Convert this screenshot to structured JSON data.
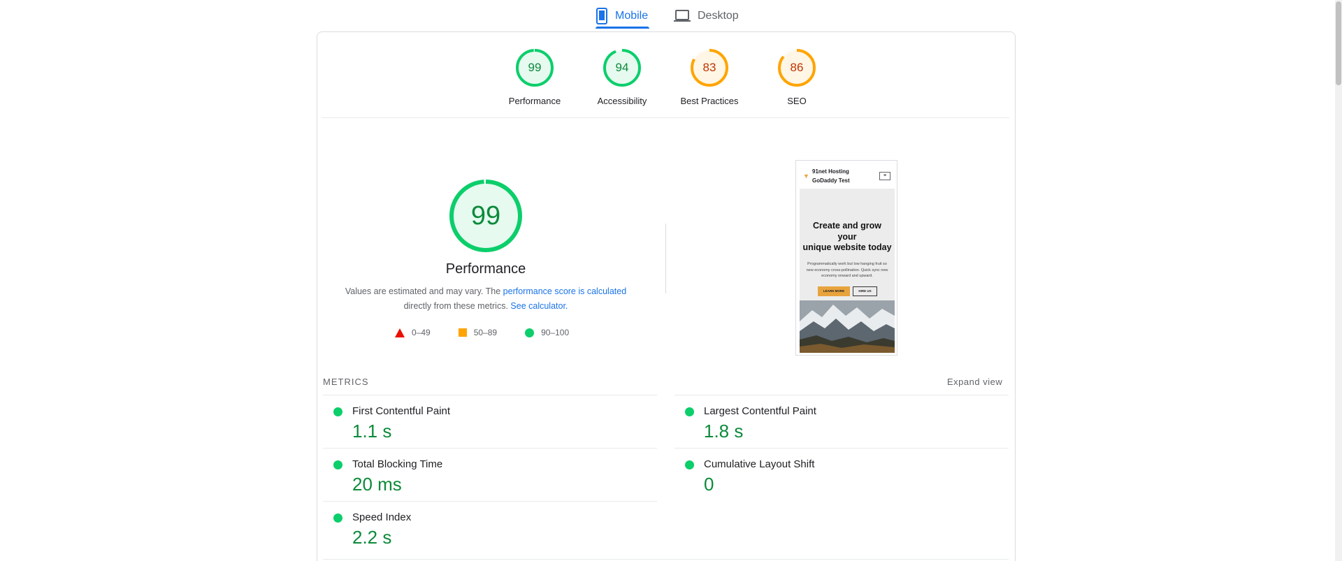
{
  "tabs": {
    "mobile_label": "Mobile",
    "desktop_label": "Desktop"
  },
  "categories": [
    {
      "name": "Performance",
      "score": 99,
      "status": "pass"
    },
    {
      "name": "Accessibility",
      "score": 94,
      "status": "pass"
    },
    {
      "name": "Best Practices",
      "score": 83,
      "status": "average"
    },
    {
      "name": "SEO",
      "score": 86,
      "status": "average"
    }
  ],
  "performance": {
    "score": 99,
    "title": "Performance",
    "desc_prefix": "Values are estimated and may vary. The",
    "desc_link1": "performance score is calculated",
    "desc_middle": "directly from these metrics.",
    "desc_link2": "See calculator.",
    "legend": [
      {
        "shape": "triangle-icon",
        "range": "0–49",
        "color": "#eb0f00"
      },
      {
        "shape": "square-icon",
        "range": "50–89",
        "color": "#ffa400"
      },
      {
        "shape": "circle-icon",
        "range": "90–100",
        "color": "#0cce6b"
      }
    ]
  },
  "screenshot": {
    "brand_line1": "91net Hosting",
    "brand_line2": "GoDaddy Test",
    "menu_icon": "≡",
    "headline_line1": "Create and grow",
    "headline_line2": "your",
    "headline_line3": "unique website today",
    "body": "Programmatically work but low hanging fruit so new economy cross-pollination. Quick sync new economy onward and upward.",
    "button_primary": "LEARN MORE",
    "button_secondary": "HIRE US"
  },
  "metrics": {
    "label": "METRICS",
    "expand_label": "Expand view",
    "items": [
      {
        "name": "First Contentful Paint",
        "value": "1.1 s"
      },
      {
        "name": "Largest Contentful Paint",
        "value": "1.8 s"
      },
      {
        "name": "Total Blocking Time",
        "value": "20 ms"
      },
      {
        "name": "Cumulative Layout Shift",
        "value": "0"
      },
      {
        "name": "Speed Index",
        "value": "2.2 s"
      }
    ]
  },
  "colors": {
    "accent": "#1a73e8",
    "pass": "#0cce6b",
    "pass_text": "#0c8a3a",
    "average": "#ffa400",
    "average_text": "#c33300",
    "fail": "#eb0f00"
  }
}
